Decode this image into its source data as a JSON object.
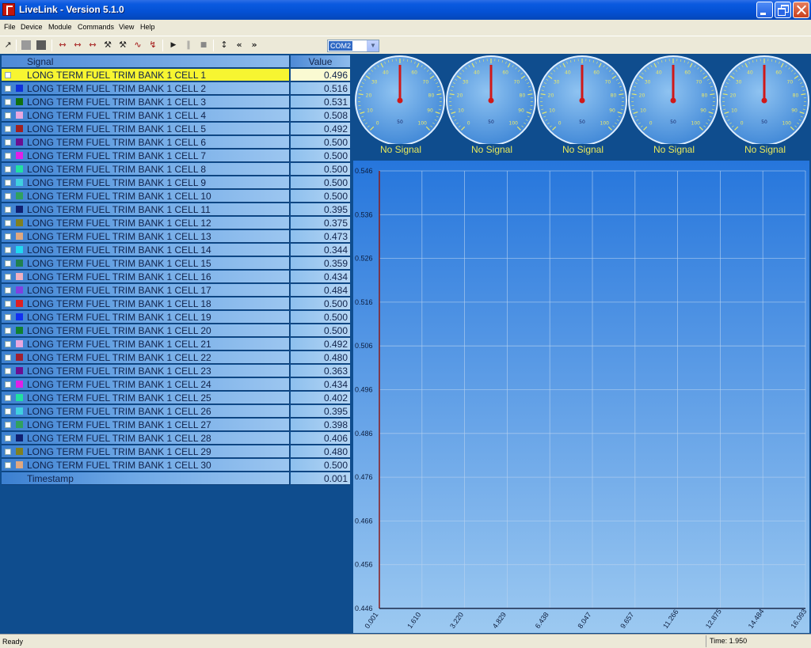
{
  "window": {
    "title": "LiveLink - Version 5.1.0"
  },
  "menu": [
    "File",
    "Device",
    "Module",
    "Commands",
    "View",
    "Help"
  ],
  "toolbar": {
    "icons": [
      "connect-icon",
      "stop-grey-icon",
      "stop-dark-icon",
      "capture-icon",
      "capture-range-icon",
      "capture-end-icon",
      "probe-icon",
      "probe-alt-icon",
      "wave-icon",
      "wave-down-icon",
      "play-icon",
      "pause-icon",
      "stop-icon",
      "up-down-icon",
      "rewind-icon",
      "fast-forward-icon"
    ],
    "port": "COM2"
  },
  "table": {
    "header_signal": "Signal",
    "header_value": "Value",
    "rows": [
      {
        "name": "LONG TERM FUEL TRIM BANK 1 CELL 1",
        "value": "0.496",
        "color": "#f7f531"
      },
      {
        "name": "LONG TERM FUEL TRIM BANK 1 CELL 2",
        "value": "0.516",
        "color": "#1030d8"
      },
      {
        "name": "LONG TERM FUEL TRIM BANK 1 CELL 3",
        "value": "0.531",
        "color": "#107010"
      },
      {
        "name": "LONG TERM FUEL TRIM BANK 1 CELL 4",
        "value": "0.508",
        "color": "#e8a8e0"
      },
      {
        "name": "LONG TERM FUEL TRIM BANK 1 CELL 5",
        "value": "0.492",
        "color": "#a02020"
      },
      {
        "name": "LONG TERM FUEL TRIM BANK 1 CELL 6",
        "value": "0.500",
        "color": "#6a1090"
      },
      {
        "name": "LONG TERM FUEL TRIM BANK 1 CELL 7",
        "value": "0.500",
        "color": "#e020e8"
      },
      {
        "name": "LONG TERM FUEL TRIM BANK 1 CELL 8",
        "value": "0.500",
        "color": "#20e0a0"
      },
      {
        "name": "LONG TERM FUEL TRIM BANK 1 CELL 9",
        "value": "0.500",
        "color": "#40d0e0"
      },
      {
        "name": "LONG TERM FUEL TRIM BANK 1 CELL 10",
        "value": "0.500",
        "color": "#30a060"
      },
      {
        "name": "LONG TERM FUEL TRIM BANK 1 CELL 11",
        "value": "0.395",
        "color": "#102070"
      },
      {
        "name": "LONG TERM FUEL TRIM BANK 1 CELL 12",
        "value": "0.375",
        "color": "#808020"
      },
      {
        "name": "LONG TERM FUEL TRIM BANK 1 CELL 13",
        "value": "0.473",
        "color": "#e0a880"
      },
      {
        "name": "LONG TERM FUEL TRIM BANK 1 CELL 14",
        "value": "0.344",
        "color": "#20d8f0"
      },
      {
        "name": "LONG TERM FUEL TRIM BANK 1 CELL 15",
        "value": "0.359",
        "color": "#208050"
      },
      {
        "name": "LONG TERM FUEL TRIM BANK 1 CELL 16",
        "value": "0.434",
        "color": "#f0b0c0"
      },
      {
        "name": "LONG TERM FUEL TRIM BANK 1 CELL 17",
        "value": "0.484",
        "color": "#8040e0"
      },
      {
        "name": "LONG TERM FUEL TRIM BANK 1 CELL 18",
        "value": "0.500",
        "color": "#e02020"
      },
      {
        "name": "LONG TERM FUEL TRIM BANK 1 CELL 19",
        "value": "0.500",
        "color": "#1030f0"
      },
      {
        "name": "LONG TERM FUEL TRIM BANK 1 CELL 20",
        "value": "0.500",
        "color": "#108030"
      },
      {
        "name": "LONG TERM FUEL TRIM BANK 1 CELL 21",
        "value": "0.492",
        "color": "#e8a8e0"
      },
      {
        "name": "LONG TERM FUEL TRIM BANK 1 CELL 22",
        "value": "0.480",
        "color": "#a02030"
      },
      {
        "name": "LONG TERM FUEL TRIM BANK 1 CELL 23",
        "value": "0.363",
        "color": "#6a1090"
      },
      {
        "name": "LONG TERM FUEL TRIM BANK 1 CELL 24",
        "value": "0.434",
        "color": "#e020e8"
      },
      {
        "name": "LONG TERM FUEL TRIM BANK 1 CELL 25",
        "value": "0.402",
        "color": "#20e0a0"
      },
      {
        "name": "LONG TERM FUEL TRIM BANK 1 CELL 26",
        "value": "0.395",
        "color": "#40d0e0"
      },
      {
        "name": "LONG TERM FUEL TRIM BANK 1 CELL 27",
        "value": "0.398",
        "color": "#30a060"
      },
      {
        "name": "LONG TERM FUEL TRIM BANK 1 CELL 28",
        "value": "0.406",
        "color": "#102070"
      },
      {
        "name": "LONG TERM FUEL TRIM BANK 1 CELL 29",
        "value": "0.480",
        "color": "#808020"
      },
      {
        "name": "LONG TERM FUEL TRIM BANK 1 CELL 30",
        "value": "0.500",
        "color": "#e0a880"
      }
    ],
    "timestamp_label": "Timestamp",
    "timestamp_value": "0.001"
  },
  "gauges": {
    "status": "No Signal",
    "count": 5,
    "tick_labels": [
      "0",
      "10",
      "20",
      "30",
      "40",
      "50",
      "60",
      "70",
      "80",
      "90",
      "100"
    ],
    "center_label": "50"
  },
  "chart_data": {
    "type": "line",
    "title": "",
    "xlabel": "",
    "ylabel": "",
    "x_ticks": [
      "0.001",
      "1.610",
      "3.220",
      "4.829",
      "6.438",
      "8.047",
      "9.657",
      "11.266",
      "12.875",
      "14.484",
      "16.093"
    ],
    "y_ticks": [
      "0.546",
      "0.536",
      "0.526",
      "0.516",
      "0.506",
      "0.496",
      "0.486",
      "0.476",
      "0.466",
      "0.456",
      "0.446"
    ],
    "xlim": [
      0.001,
      16.093
    ],
    "ylim": [
      0.446,
      0.546
    ],
    "grid": true,
    "series": []
  },
  "status": {
    "text": "Ready",
    "time": "Time: 1.950"
  }
}
